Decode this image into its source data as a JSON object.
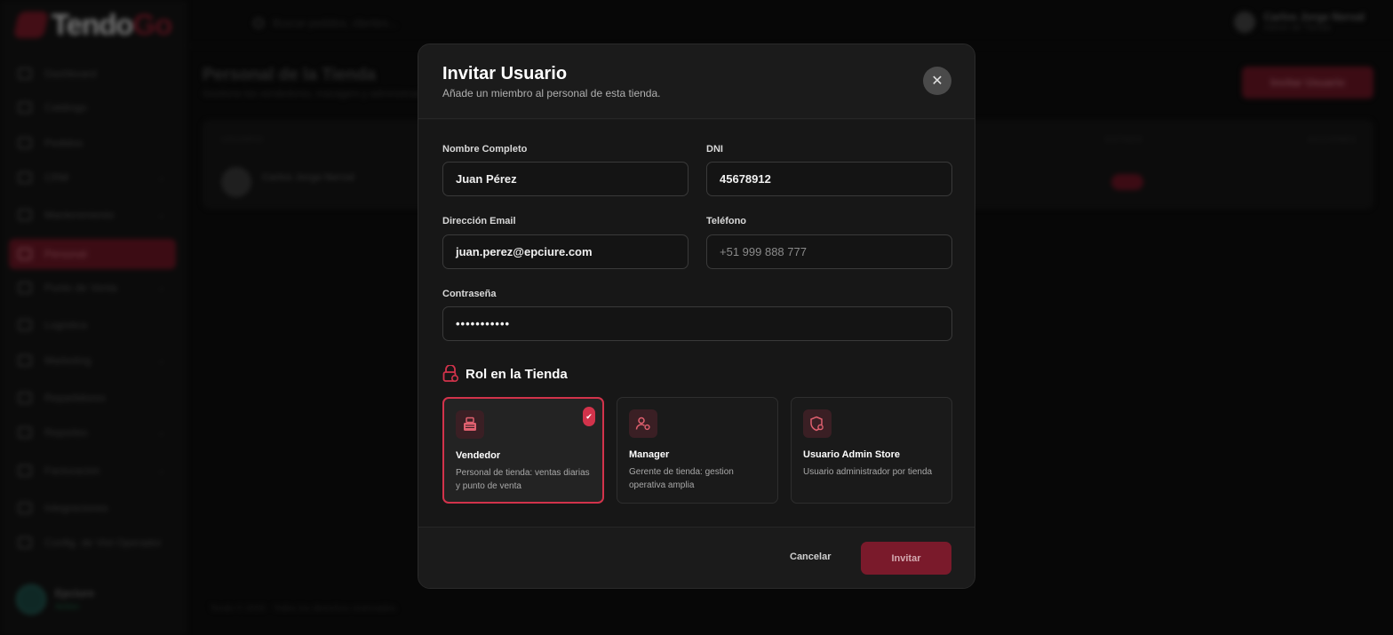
{
  "background": {
    "logo": {
      "text_main": "Tendo",
      "text_accent": "Go"
    },
    "sidebar": {
      "items": [
        {
          "label": "Dashboard",
          "chevron": false
        },
        {
          "label": "Catálogo",
          "chevron": false
        },
        {
          "label": "Pedidos",
          "chevron": false
        },
        {
          "label": "CRM",
          "chevron": true
        },
        {
          "label": "Mantenimiento",
          "chevron": true
        },
        {
          "label": "Personal",
          "chevron": false,
          "active": true
        },
        {
          "label": "Punto de Venta",
          "chevron": true
        },
        {
          "label": "Logística",
          "chevron": false
        },
        {
          "label": "Marketing",
          "chevron": true
        },
        {
          "label": "Repartidores",
          "chevron": false
        },
        {
          "label": "Reportes",
          "chevron": true
        },
        {
          "label": "Facturación",
          "chevron": true
        },
        {
          "label": "Integraciones",
          "chevron": false
        },
        {
          "label": "Config. de Vist Operador",
          "chevron": false
        }
      ],
      "org_name": "Epciure",
      "org_sub": "Activo"
    },
    "topbar": {
      "search_placeholder": "Buscar pedidos, clientes...",
      "user_name": "Carlos Jorge Nerval",
      "user_role": "Admin de Tienda"
    },
    "page": {
      "title": "Personal de la Tienda",
      "subtitle": "Gestione los vendedores, managers y administradores",
      "invite_label": "Invitar Usuario",
      "table_headers": {
        "user": "USUARIO",
        "status": "ESTADO",
        "actions": "ACCIONES"
      },
      "row_name": "Carlos Jorge Nerval"
    },
    "footer": "Tendo © 2025  ·  Todos los derechos reservados"
  },
  "modal": {
    "title": "Invitar Usuario",
    "subtitle": "Añade un miembro al personal de esta tienda.",
    "close_icon": "close-icon",
    "fields": {
      "full_name": {
        "label": "Nombre Completo",
        "value": "Juan Pérez"
      },
      "dni": {
        "label": "DNI",
        "value": "45678912"
      },
      "email": {
        "label": "Dirección Email",
        "value": "juan.perez@epciure.com"
      },
      "phone": {
        "label": "Teléfono",
        "value": "",
        "placeholder": "+51 999 888 777"
      },
      "password": {
        "label": "Contraseña",
        "value": "•••••••••••"
      }
    },
    "role_section": {
      "title": "Rol en la Tienda",
      "roles": [
        {
          "name": "Vendedor",
          "description": "Personal de tienda: ventas diarias y punto de venta",
          "icon": "cash-register-icon",
          "selected": true
        },
        {
          "name": "Manager",
          "description": "Gerente de tienda: gestion operativa amplia",
          "icon": "user-gear-icon",
          "selected": false
        },
        {
          "name": "Usuario Admin Store",
          "description": "Usuario administrador por tienda",
          "icon": "shield-gear-icon",
          "selected": false
        }
      ]
    },
    "actions": {
      "cancel": "Cancelar",
      "submit": "Invitar"
    },
    "colors": {
      "accent": "#d2334b",
      "submit_bg": "#7a1a2b",
      "modal_bg": "#1b1b1b"
    }
  }
}
